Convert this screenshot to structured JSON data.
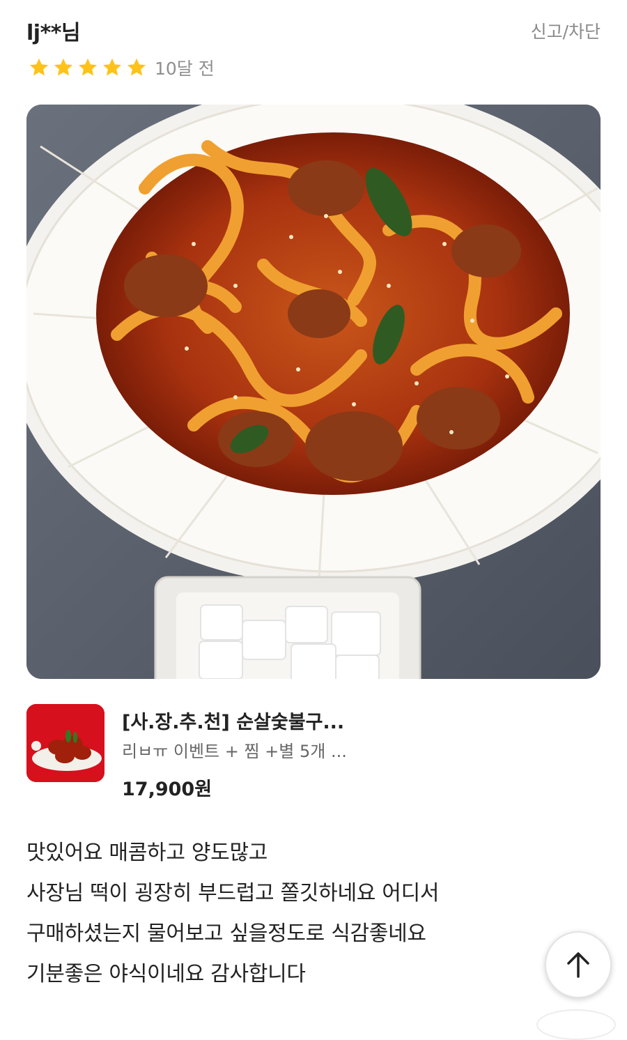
{
  "review": {
    "username": "lj**님",
    "report_label": "신고/차단",
    "rating": 5,
    "rating_max": 5,
    "date": "10달 전",
    "star_color": "#FFC21A",
    "text_lines": [
      "맛있어요 매콤하고 양도많고",
      "사장님 떡이 굉장히 부드럽고 쫄깃하네요 어디서",
      "구매하셨는지 물어보고 싶을정도로 식감좋네요",
      "기분좋은 야식이네요 감사합니다"
    ]
  },
  "product": {
    "name": "[사.장.추.천] 순살숯불구...",
    "option": "리ㅂㅠ 이벤트 + 찜 +별 5개 ...",
    "price": "17,900원",
    "thumb_bg": "#D6101C"
  },
  "icons": {
    "scroll_top": "arrow-up-icon",
    "star": "star-icon"
  }
}
